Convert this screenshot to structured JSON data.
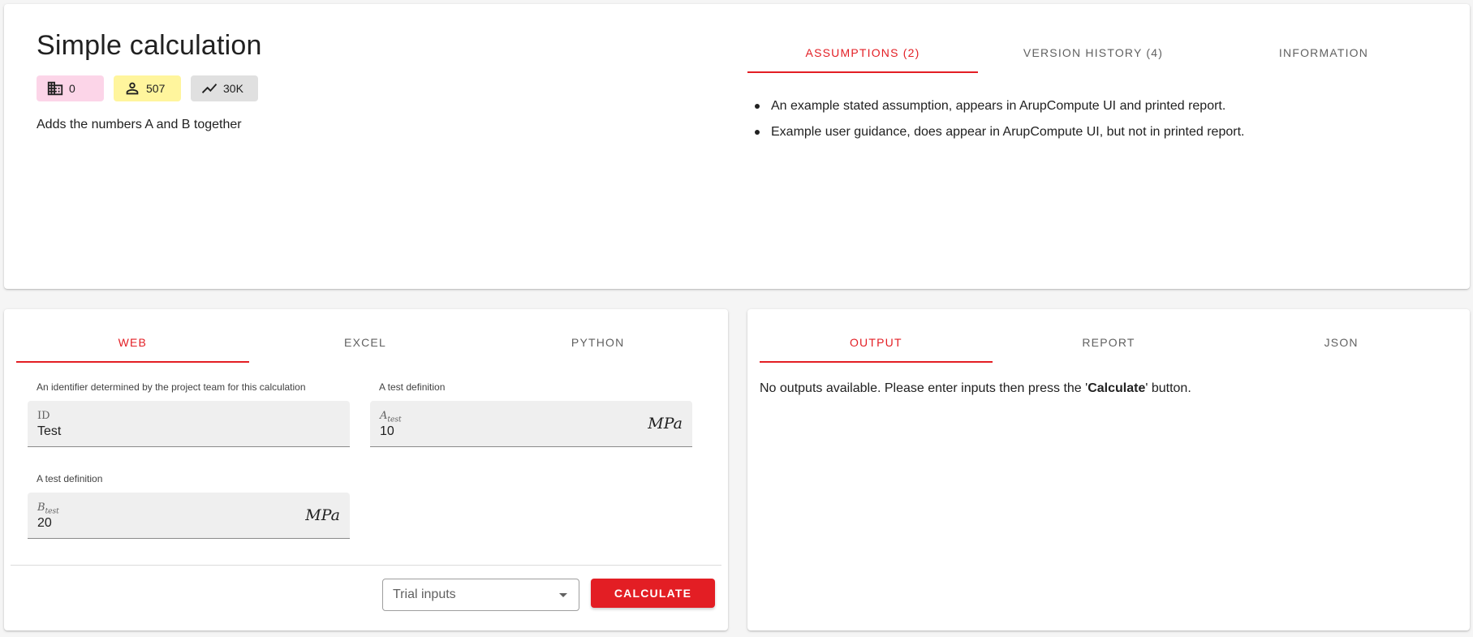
{
  "header": {
    "title": "Simple calculation",
    "chips": {
      "buildings": {
        "icon": "building-icon",
        "value": "0",
        "color": "#fcd5e8"
      },
      "users": {
        "icon": "person-icon",
        "value": "507",
        "color": "#fff59d"
      },
      "runs": {
        "icon": "trending-icon",
        "value": "30K",
        "color": "#e0e0e0"
      }
    },
    "description": "Adds the numbers A and B together"
  },
  "info_tabs": [
    {
      "label": "ASSUMPTIONS (2)",
      "active": true
    },
    {
      "label": "VERSION HISTORY (4)",
      "active": false
    },
    {
      "label": "INFORMATION",
      "active": false
    }
  ],
  "assumptions": [
    "An example stated assumption, appears in ArupCompute UI and printed report.",
    "Example user guidance, does appear in ArupCompute UI, but not in printed report."
  ],
  "input_tabs": [
    {
      "label": "WEB",
      "active": true
    },
    {
      "label": "EXCEL",
      "active": false
    },
    {
      "label": "PYTHON",
      "active": false
    }
  ],
  "inputs": {
    "id_field": {
      "hint": "An identifier determined by the project team for this calculation",
      "label": "ID",
      "value": "Test"
    },
    "a_field": {
      "hint": "A test definition",
      "label_main": "A",
      "label_sub": "test",
      "value": "10",
      "unit": "MPa"
    },
    "b_field": {
      "hint": "A test definition",
      "label_main": "B",
      "label_sub": "test",
      "value": "20",
      "unit": "MPa"
    }
  },
  "actions": {
    "trial_select": "Trial inputs",
    "calculate_label": "CALCULATE"
  },
  "output_tabs": [
    {
      "label": "OUTPUT",
      "active": true
    },
    {
      "label": "REPORT",
      "active": false
    },
    {
      "label": "JSON",
      "active": false
    }
  ],
  "output": {
    "message_before": "No outputs available. Please enter inputs then press the '",
    "message_bold": "Calculate",
    "message_after": "' button."
  },
  "colors": {
    "accent": "#e31e24"
  }
}
